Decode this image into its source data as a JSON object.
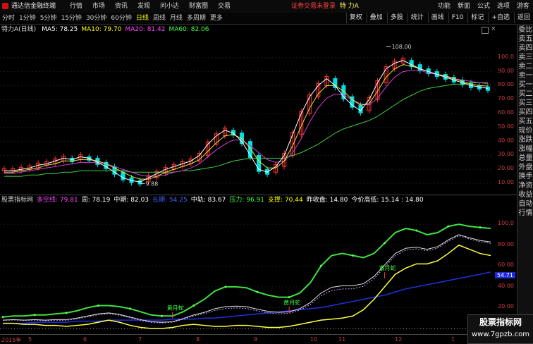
{
  "topbar": {
    "app_title": "通达信金融终端",
    "menus": [
      "行情",
      "市场",
      "资讯",
      "发现",
      "问小达",
      "财富圈",
      "交易"
    ],
    "notice": "证券交易未登录",
    "stock_name": "特 力A",
    "right_menus": [
      "功能",
      "新面",
      "公式",
      "选项",
      "游客"
    ]
  },
  "periodbar": {
    "periods": [
      "分时",
      "1分钟",
      "5分钟",
      "15分钟",
      "30分钟",
      "60分钟",
      "日线",
      "周线",
      "月线",
      "多周期",
      "更多"
    ],
    "active": "日线",
    "tools": [
      "复权",
      "叠加",
      "多股",
      "统计",
      "画线",
      "F10",
      "标记",
      "+自选",
      "返回"
    ]
  },
  "main_legend": {
    "title": "特力A(日线)",
    "ma": [
      {
        "label": "MA5: 78.25",
        "color": "#ffffff"
      },
      {
        "label": "MA10: 79.70",
        "color": "#ffff00"
      },
      {
        "label": "MA20: 81.42",
        "color": "#ff44ff"
      },
      {
        "label": "MA60: 82.06",
        "color": "#44ff44"
      }
    ]
  },
  "main_chart": {
    "yticks": [
      "100.0",
      "90.00",
      "80.00",
      "70.00",
      "60.00",
      "50.00",
      "40.00",
      "30.00",
      "20.00",
      "10.00"
    ],
    "high_label": "108.00",
    "low_label": "9.88"
  },
  "sub_legend": {
    "items": [
      {
        "label": "股票指标网",
        "color": "#cccccc"
      },
      {
        "label": "多空线: 79.81",
        "color": "#ff44ff"
      },
      {
        "label": "周: 78.19",
        "color": "#ffffff"
      },
      {
        "label": "中期: 82.03",
        "color": "#ffffff"
      },
      {
        "label": "长期: 54.25",
        "color": "#4060ff"
      },
      {
        "label": "中轨: 83.67",
        "color": "#ffffff"
      },
      {
        "label": "压力: 96.91",
        "color": "#44ff44"
      },
      {
        "label": "支撑: 70.44",
        "color": "#ffff00"
      },
      {
        "label": "昨收盘: 14.80",
        "color": "#ffffff"
      },
      {
        "label": "今价高低: 15.14 : 14.80",
        "color": "#ffffff"
      }
    ]
  },
  "sub_chart": {
    "yticks": [
      "100.0",
      "80.00",
      "60.00",
      "40.00",
      "20.00"
    ],
    "current_value": "54.71",
    "signal_label": "黄月蛇"
  },
  "xaxis": {
    "ticks": [
      "2015年",
      "5",
      "6",
      "7",
      "8",
      "9",
      "10",
      "11",
      "12",
      "1"
    ]
  },
  "sidebar": {
    "items": [
      "委比",
      "卖五",
      "卖四",
      "卖三",
      "卖二",
      "卖一",
      "买一",
      "买二",
      "买三",
      "买四",
      "买五",
      "现价",
      "涨跌",
      "涨幅",
      "总量",
      "外盘",
      "换手",
      "净资",
      "收益",
      "自动",
      "行情"
    ]
  },
  "watermark": {
    "line1": "股票指标网",
    "line2": "www.7gpzb.com"
  },
  "chart_data": {
    "type": "candlestick",
    "main_y_range": [
      5,
      113
    ],
    "sub_y_range": [
      0,
      115
    ],
    "ma5": [
      19,
      19,
      20,
      21,
      23,
      24,
      26,
      28,
      27,
      29,
      28,
      25,
      22,
      18,
      14,
      12,
      11,
      14,
      17,
      20,
      22,
      24,
      26,
      30,
      38,
      44,
      48,
      46,
      40,
      30,
      20,
      18,
      22,
      30,
      45,
      60,
      72,
      80,
      85,
      80,
      72,
      66,
      62,
      70,
      82,
      92,
      96,
      98,
      95,
      92,
      90,
      88,
      86,
      84,
      82,
      80,
      79,
      78
    ],
    "ma10": [
      18,
      18,
      19,
      20,
      21,
      23,
      24,
      26,
      26,
      27,
      27,
      26,
      24,
      21,
      18,
      15,
      13,
      13,
      15,
      18,
      20,
      22,
      24,
      27,
      33,
      39,
      44,
      45,
      42,
      35,
      26,
      21,
      21,
      26,
      37,
      51,
      64,
      74,
      80,
      80,
      76,
      70,
      66,
      67,
      76,
      86,
      92,
      95,
      94,
      92,
      90,
      88,
      87,
      85,
      83,
      81,
      80,
      79.7
    ],
    "ma20": [
      17,
      17,
      18,
      19,
      20,
      21,
      22,
      23,
      24,
      25,
      25,
      25,
      24,
      22,
      20,
      18,
      16,
      15,
      15,
      16,
      18,
      19,
      21,
      24,
      29,
      34,
      38,
      41,
      41,
      37,
      32,
      27,
      25,
      26,
      32,
      42,
      54,
      64,
      71,
      74,
      73,
      70,
      67,
      66,
      71,
      79,
      86,
      90,
      91,
      91,
      89,
      88,
      86,
      85,
      84,
      83,
      82,
      81.4
    ],
    "ma60": [
      15,
      15,
      15,
      16,
      16,
      17,
      17,
      18,
      18,
      19,
      19,
      19,
      19,
      19,
      19,
      18,
      18,
      18,
      18,
      18,
      18,
      19,
      19,
      20,
      21,
      22,
      24,
      26,
      27,
      28,
      28,
      28,
      28,
      28,
      30,
      32,
      35,
      38,
      42,
      46,
      49,
      51,
      53,
      55,
      58,
      62,
      66,
      70,
      73,
      76,
      78,
      79,
      80,
      81,
      81,
      82,
      82,
      82.06
    ],
    "pressure": [
      11,
      12,
      12,
      13,
      13,
      14,
      15,
      17,
      20,
      22,
      22,
      21,
      19,
      16,
      13,
      12,
      12,
      16,
      22,
      28,
      36,
      40,
      40,
      39,
      35,
      32,
      30,
      30,
      34,
      44,
      60,
      70,
      72,
      70,
      68,
      72,
      82,
      92,
      96,
      94,
      90,
      92,
      98,
      100,
      98,
      97,
      96
    ],
    "support": [
      5,
      5,
      4,
      4,
      3,
      3,
      2,
      3,
      4,
      6,
      8,
      6,
      3,
      1,
      0,
      0,
      1,
      3,
      4,
      3,
      2,
      2,
      3,
      3,
      2,
      1,
      1,
      2,
      4,
      6,
      8,
      9,
      10,
      12,
      18,
      28,
      40,
      52,
      58,
      62,
      62,
      65,
      72,
      80,
      76,
      72,
      70
    ],
    "longterm": [
      5,
      5,
      5,
      6,
      6,
      6,
      6,
      7,
      7,
      7,
      8,
      8,
      8,
      8,
      8,
      8,
      9,
      9,
      9,
      10,
      10,
      11,
      12,
      13,
      14,
      15,
      16,
      17,
      18,
      19,
      20,
      22,
      24,
      26,
      28,
      30,
      32,
      35,
      38,
      40,
      42,
      44,
      46,
      48,
      50,
      52,
      54.25
    ]
  }
}
